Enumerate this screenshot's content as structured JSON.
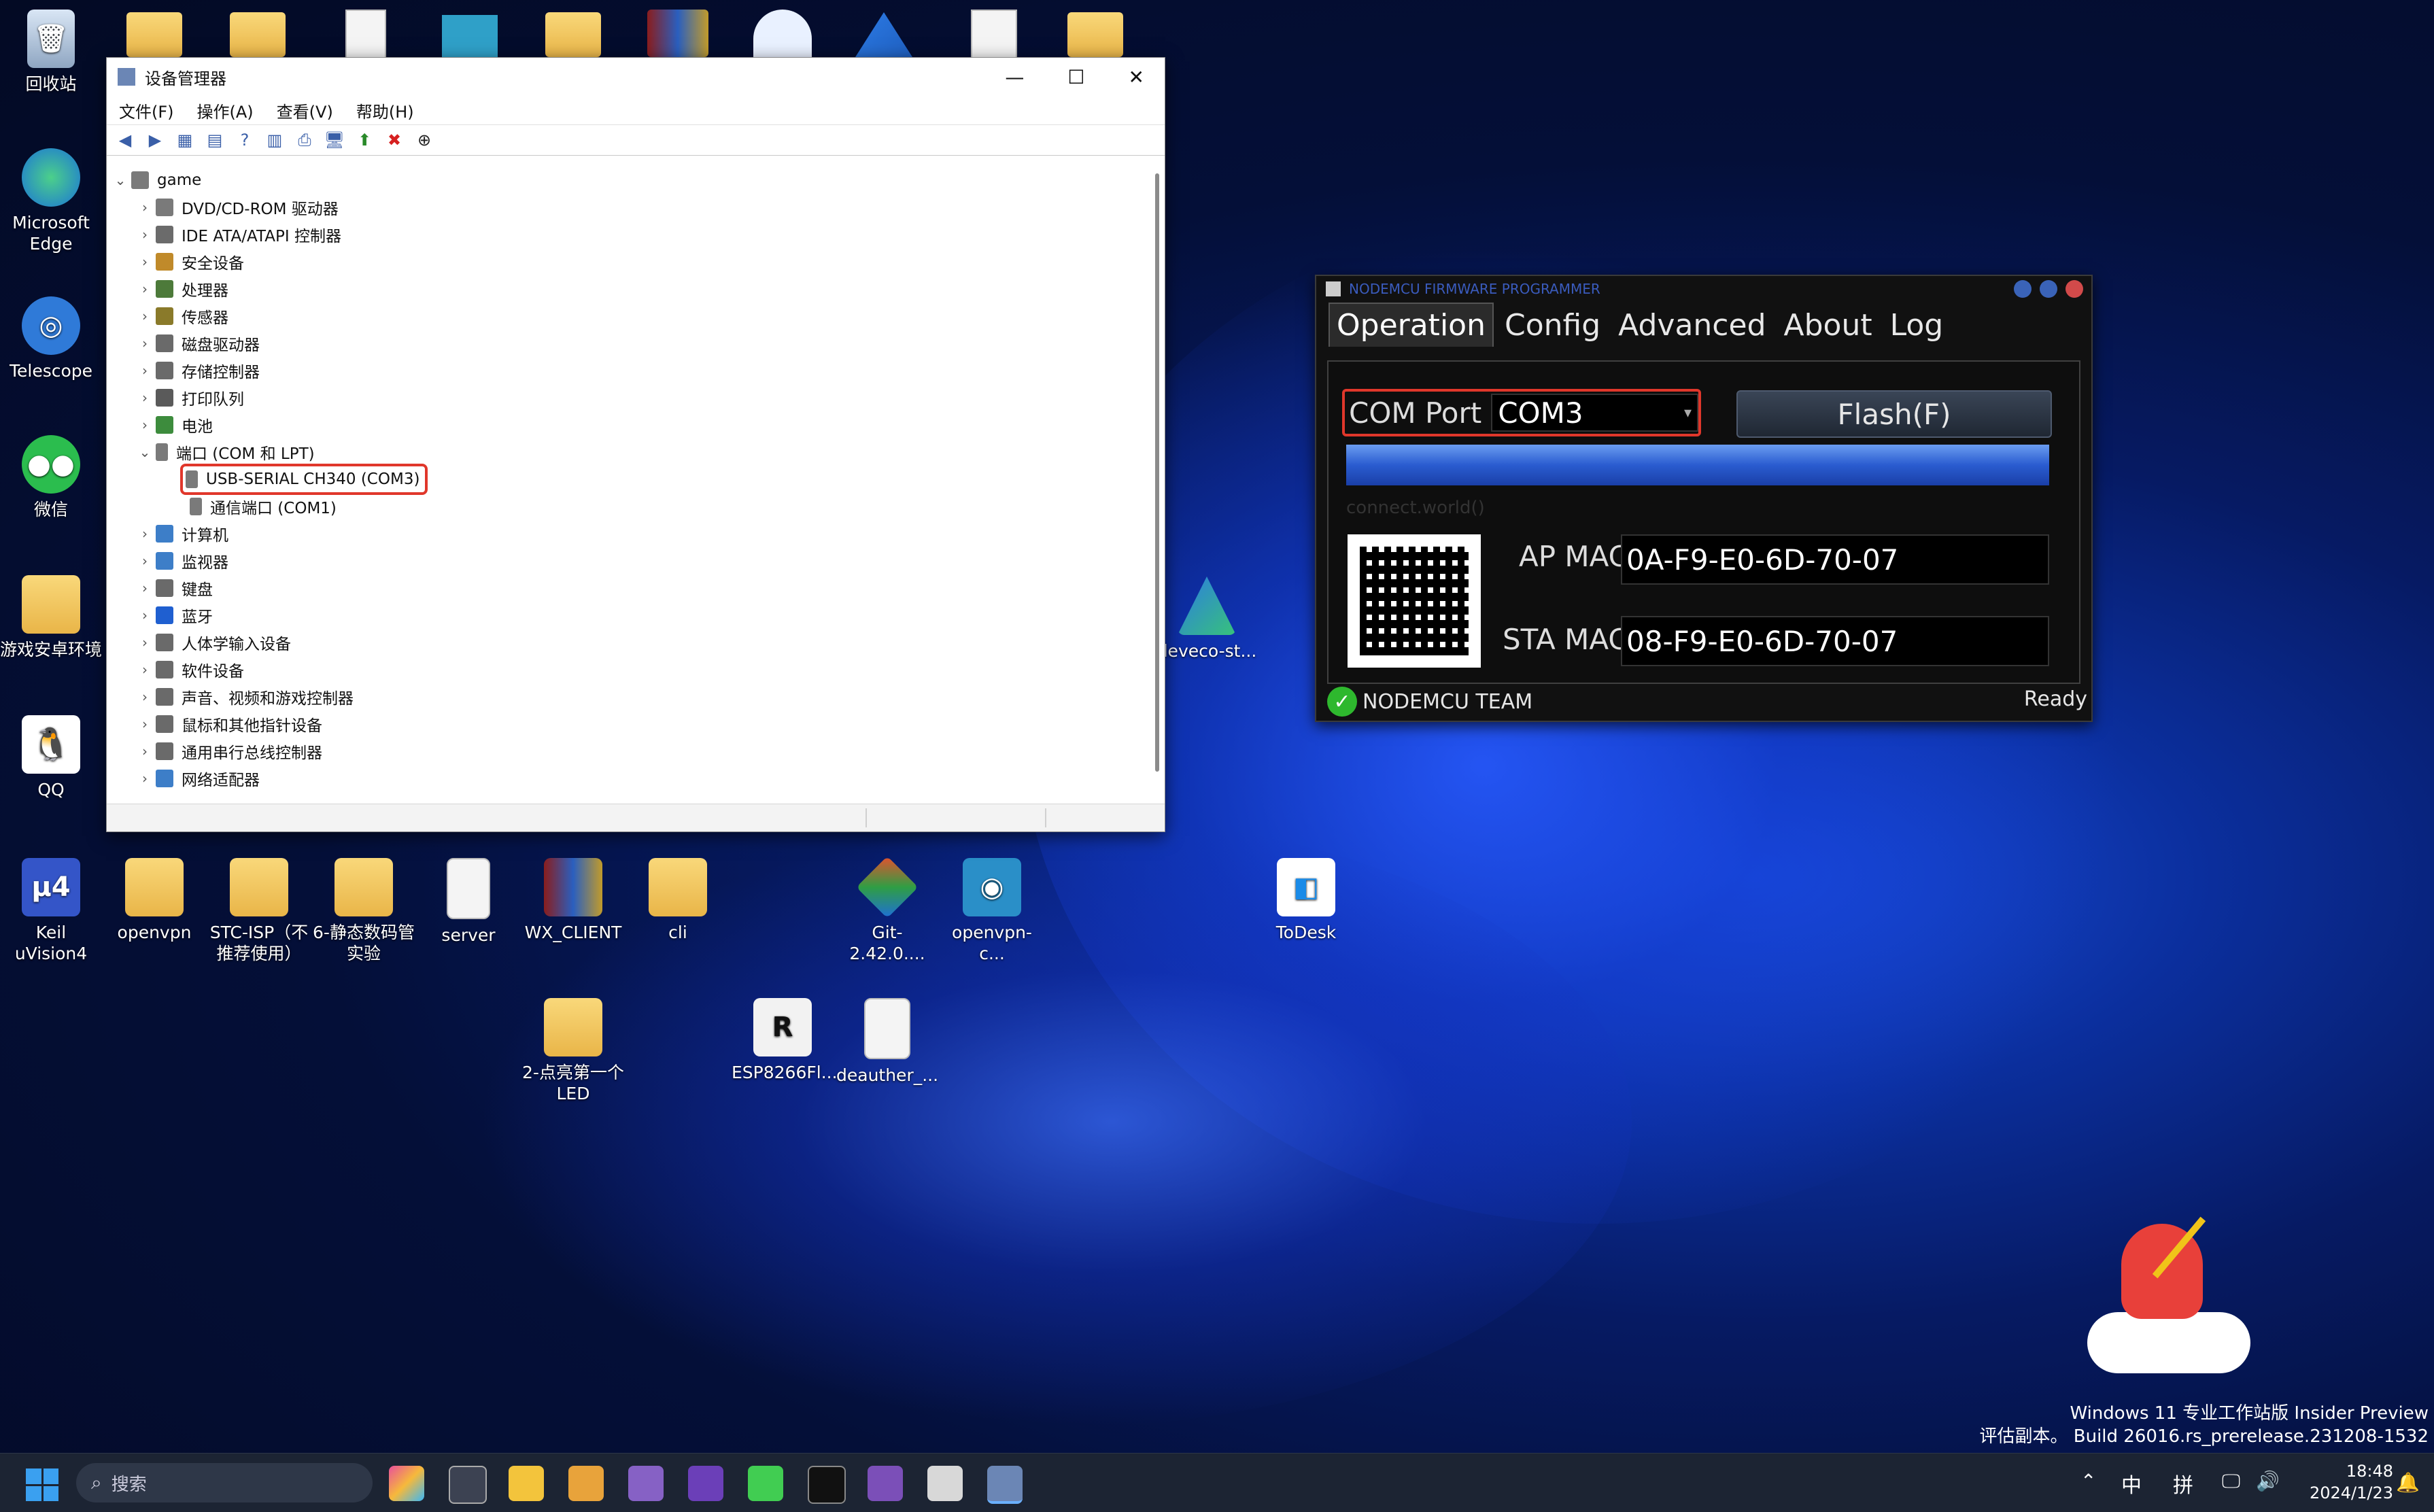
{
  "desktop": {
    "icons_left": [
      {
        "label": "回收站"
      },
      {
        "label": "Microsoft Edge"
      },
      {
        "label": "Telescope"
      },
      {
        "label": "微信"
      },
      {
        "label": "游戏安卓环境"
      },
      {
        "label": "QQ"
      },
      {
        "label": "Keil uVision4"
      }
    ],
    "icons_row": [
      {
        "label": "openvpn"
      },
      {
        "label": "STC-ISP（不推荐使用）"
      },
      {
        "label": "6-静态数码管实验"
      },
      {
        "label": "server"
      },
      {
        "label": "WX_CLIENT"
      },
      {
        "label": "cli"
      },
      {
        "label": "Git-2.42.0...."
      },
      {
        "label": "openvpn-c..."
      },
      {
        "label": "ToDesk"
      }
    ],
    "icons_row2": [
      {
        "label": "2-点亮第一个LED"
      },
      {
        "label": "ESP8266Fl..."
      },
      {
        "label": "deauther_..."
      }
    ],
    "deveco_label": "deveco-st...",
    "watermark_line1": "Windows 11 专业工作站版 Insider Preview",
    "watermark_line2": "评估副本。 Build 26016.rs_prerelease.231208-1532"
  },
  "devmgr": {
    "title": "设备管理器",
    "menus": [
      "文件(F)",
      "操作(A)",
      "查看(V)",
      "帮助(H)"
    ],
    "root": "game",
    "items": [
      {
        "label": "DVD/CD-ROM 驱动器",
        "color": "#7a7a7a"
      },
      {
        "label": "IDE ATA/ATAPI 控制器",
        "color": "#6b6b6b"
      },
      {
        "label": "安全设备",
        "color": "#c08a2a"
      },
      {
        "label": "处理器",
        "color": "#4d7a3a"
      },
      {
        "label": "传感器",
        "color": "#8a7a2a"
      },
      {
        "label": "磁盘驱动器",
        "color": "#6a6a6a"
      },
      {
        "label": "存储控制器",
        "color": "#6a6a6a"
      },
      {
        "label": "打印队列",
        "color": "#5a5a5a"
      },
      {
        "label": "电池",
        "color": "#3d8c3d"
      }
    ],
    "ports_label": "端口 (COM 和 LPT)",
    "port_children": [
      "USB-SERIAL CH340 (COM3)",
      "通信端口 (COM1)"
    ],
    "items_after": [
      {
        "label": "计算机",
        "color": "#3d7ec8"
      },
      {
        "label": "监视器",
        "color": "#3d7ec8"
      },
      {
        "label": "键盘",
        "color": "#6a6a6a"
      },
      {
        "label": "蓝牙",
        "color": "#1f5fd0"
      },
      {
        "label": "人体学输入设备",
        "color": "#6a6a6a"
      },
      {
        "label": "软件设备",
        "color": "#6a6a6a"
      },
      {
        "label": "声音、视频和游戏控制器",
        "color": "#6a6a6a"
      },
      {
        "label": "鼠标和其他指针设备",
        "color": "#6a6a6a"
      },
      {
        "label": "通用串行总线控制器",
        "color": "#6a6a6a"
      },
      {
        "label": "网络适配器",
        "color": "#3d7ec8"
      }
    ]
  },
  "nodemcu": {
    "title": "NODEMCU FIRMWARE PROGRAMMER",
    "tabs": [
      "Operation",
      "Config",
      "Advanced",
      "About",
      "Log"
    ],
    "com_label": "COM Port",
    "com_value": "COM3",
    "flash_label": "Flash(F)",
    "status_line": "connect.world()",
    "ap_mac_label": "AP MAC",
    "ap_mac": "0A-F9-E0-6D-70-07",
    "sta_mac_label": "STA MAC",
    "sta_mac": "08-F9-E0-6D-70-07",
    "team": "NODEMCU TEAM",
    "ready": "Ready"
  },
  "taskbar": {
    "search_placeholder": "搜索",
    "ime1": "中",
    "ime2": "拼",
    "time": "18:48",
    "date": "2024/1/23"
  },
  "colors": {
    "highlight": "#e0372b",
    "nodemcu_bar": "#3d6fd6"
  }
}
